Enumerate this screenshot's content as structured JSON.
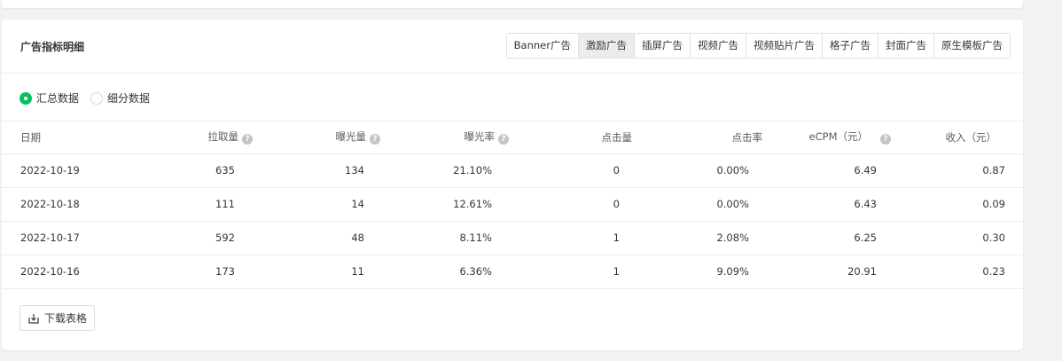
{
  "section": {
    "title": "广告指标明细"
  },
  "tabs": [
    {
      "label": "Banner广告",
      "active": false
    },
    {
      "label": "激励广告",
      "active": true
    },
    {
      "label": "插屏广告",
      "active": false
    },
    {
      "label": "视频广告",
      "active": false
    },
    {
      "label": "视频贴片广告",
      "active": false
    },
    {
      "label": "格子广告",
      "active": false
    },
    {
      "label": "封面广告",
      "active": false
    },
    {
      "label": "原生模板广告",
      "active": false
    }
  ],
  "radio": {
    "summary_label": "汇总数据",
    "detail_label": "细分数据",
    "selected": "summary"
  },
  "table": {
    "headers": [
      "日期",
      "拉取量",
      "曝光量",
      "曝光率",
      "点击量",
      "点击率",
      "eCPM（元）",
      "收入（元）"
    ],
    "help_icon": "?",
    "rows": [
      [
        "2022-10-19",
        "635",
        "134",
        "21.10%",
        "0",
        "0.00%",
        "6.49",
        "0.87"
      ],
      [
        "2022-10-18",
        "111",
        "14",
        "12.61%",
        "0",
        "0.00%",
        "6.43",
        "0.09"
      ],
      [
        "2022-10-17",
        "592",
        "48",
        "8.11%",
        "1",
        "2.08%",
        "6.25",
        "0.30"
      ],
      [
        "2022-10-16",
        "173",
        "11",
        "6.36%",
        "1",
        "9.09%",
        "20.91",
        "0.23"
      ]
    ]
  },
  "download": {
    "label": "下载表格",
    "icon": "download-icon"
  },
  "colors": {
    "accent": "#07c160",
    "active_tab_bg": "#ececec"
  }
}
